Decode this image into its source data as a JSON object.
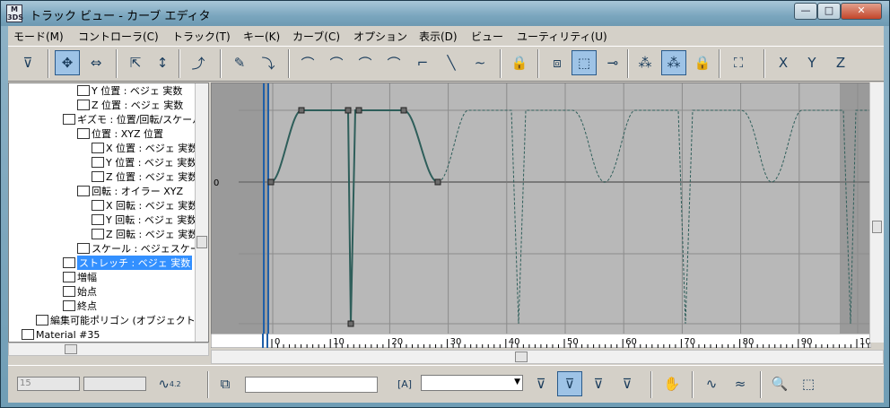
{
  "window": {
    "title": "トラック ビュー - カーブ エディタ",
    "app_icon_text": "M\n3DS",
    "minimize": "—",
    "maximize": "□",
    "close": "✕"
  },
  "menu": [
    "モード(M)",
    "コントローラ(C)",
    "トラック(T)",
    "キー(K)",
    "カーブ(C)",
    "オプション",
    "表示(D)",
    "ビュー",
    "ユーティリティ(U)"
  ],
  "toolbar": {
    "icons": [
      "filter-icon",
      "move-keys-icon",
      "slide-keys-icon",
      "scale-keys-icon",
      "scale-values-icon",
      "add-keys-icon",
      "draw-curves-icon",
      "reduce-keys-icon",
      "tangent-auto-icon",
      "tangent-custom-icon",
      "tangent-fast-icon",
      "tangent-slow-icon",
      "tangent-step-icon",
      "tangent-linear-icon",
      "tangent-smooth-icon",
      "lock-selection-icon",
      "snap-frames-icon",
      "params-curve-out-of-range-icon",
      "show-keyable-icon",
      "show-tangents-icon",
      "show-all-tangents-icon",
      "lock-tangents-icon",
      "isolate-curve-icon",
      "toggle-x-icon",
      "toggle-y-icon",
      "toggle-z-icon"
    ],
    "active_index": [
      1,
      17,
      20
    ]
  },
  "tree": [
    {
      "indent": 76,
      "label": "Y 位置 : ベジェ 実数"
    },
    {
      "indent": 76,
      "label": "Z 位置 : ベジェ 実数"
    },
    {
      "indent": 60,
      "label": "ギズモ : 位置/回転/スケール"
    },
    {
      "indent": 76,
      "label": "位置 : XYZ 位置"
    },
    {
      "indent": 92,
      "label": "X 位置 : ベジェ 実数"
    },
    {
      "indent": 92,
      "label": "Y 位置 : ベジェ 実数"
    },
    {
      "indent": 92,
      "label": "Z 位置 : ベジェ 実数"
    },
    {
      "indent": 76,
      "label": "回転 : オイラー XYZ"
    },
    {
      "indent": 92,
      "label": "X 回転 : ベジェ 実数"
    },
    {
      "indent": 92,
      "label": "Y 回転 : ベジェ 実数"
    },
    {
      "indent": 92,
      "label": "Z 回転 : ベジェ 実数"
    },
    {
      "indent": 76,
      "label": "スケール : ベジェスケール"
    },
    {
      "indent": 60,
      "label": "ストレッチ : ベジェ 実数",
      "selected": true
    },
    {
      "indent": 60,
      "label": "増幅"
    },
    {
      "indent": 60,
      "label": "始点"
    },
    {
      "indent": 60,
      "label": "終点"
    },
    {
      "indent": 30,
      "label": "編集可能ポリゴン (オブジェクト)"
    },
    {
      "indent": 14,
      "label": "Material #35"
    }
  ],
  "graph": {
    "zero_label": "0",
    "ruler_ticks": [
      "0",
      "10",
      "20",
      "30",
      "40",
      "50",
      "60",
      "70",
      "80",
      "90",
      "100"
    ],
    "colors": {
      "background": "#b8b8b8",
      "out_of_range": "#9a9a9a",
      "grid": "#8c8c8c",
      "curve": "#2e5e5a",
      "time_slider": "#1f5fa8"
    }
  },
  "status": {
    "frame_field": "15",
    "value_field": "",
    "key_count_label": "4.2",
    "selection_name_value": "",
    "combo_value": ""
  }
}
